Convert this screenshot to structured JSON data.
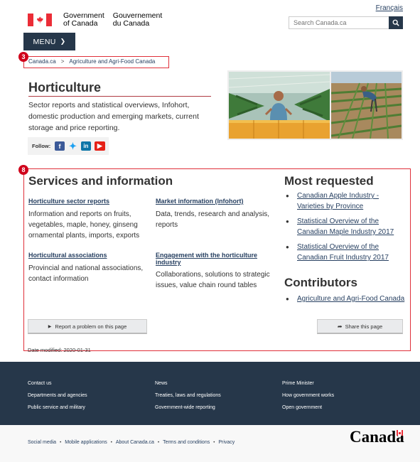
{
  "header": {
    "language_link": "Français",
    "signature_en_1": "Government",
    "signature_en_2": "of Canada",
    "signature_fr_1": "Gouvernement",
    "signature_fr_2": "du Canada",
    "search_placeholder": "Search Canada.ca",
    "menu_label": "MENU"
  },
  "markers": {
    "breadcrumb": "3",
    "services": "8"
  },
  "breadcrumb": [
    "Canada.ca",
    "Agriculture and Agri-Food Canada"
  ],
  "page": {
    "title": "Horticulture",
    "intro": "Sector reports and statistical overviews, Infohort, domestic production and emerging markets, current storage and price reporting.",
    "follow_label": "Follow:"
  },
  "services": {
    "heading": "Services and information",
    "items": [
      {
        "title": "Horticulture sector reports",
        "desc": "Information and reports on fruits, vegetables, maple, honey, ginseng ornamental plants, imports, exports"
      },
      {
        "title": "Market information (Infohort)",
        "desc": "Data, trends, research and analysis, reports"
      },
      {
        "title": "Horticultural associations",
        "desc": "Provincial and national associations, contact information"
      },
      {
        "title": "Engagement with the horticulture industry",
        "desc": "Collaborations, solutions to strategic issues, value chain round tables"
      }
    ]
  },
  "most_requested": {
    "heading": "Most requested",
    "items": [
      "Canadian Apple Industry - Varieties by Province",
      "Statistical Overview of the Canadian Maple Industry 2017",
      "Statistical Overview of the Canadian Fruit Industry 2017"
    ]
  },
  "contributors": {
    "heading": "Contributors",
    "items": [
      "Agriculture and Agri-Food Canada"
    ]
  },
  "buttons": {
    "report": "Report a problem on this page",
    "share": "Share this page"
  },
  "date_modified": "Date modified: 2020-01-31",
  "footer": {
    "col1": [
      "Contact us",
      "Departments and agencies",
      "Public service and military"
    ],
    "col2": [
      "News",
      "Treaties, laws and regulations",
      "Government-wide reporting"
    ],
    "col3": [
      "Prime Minister",
      "How government works",
      "Open government"
    ],
    "sub_links": [
      "Social media",
      "Mobile applications",
      "About Canada.ca",
      "Terms and conditions",
      "Privacy"
    ],
    "wordmark": "Canada"
  },
  "colors": {
    "navy": "#26374a",
    "link": "#284162",
    "flag_red": "#eb2d37",
    "annotation_red": "#d0021b"
  }
}
